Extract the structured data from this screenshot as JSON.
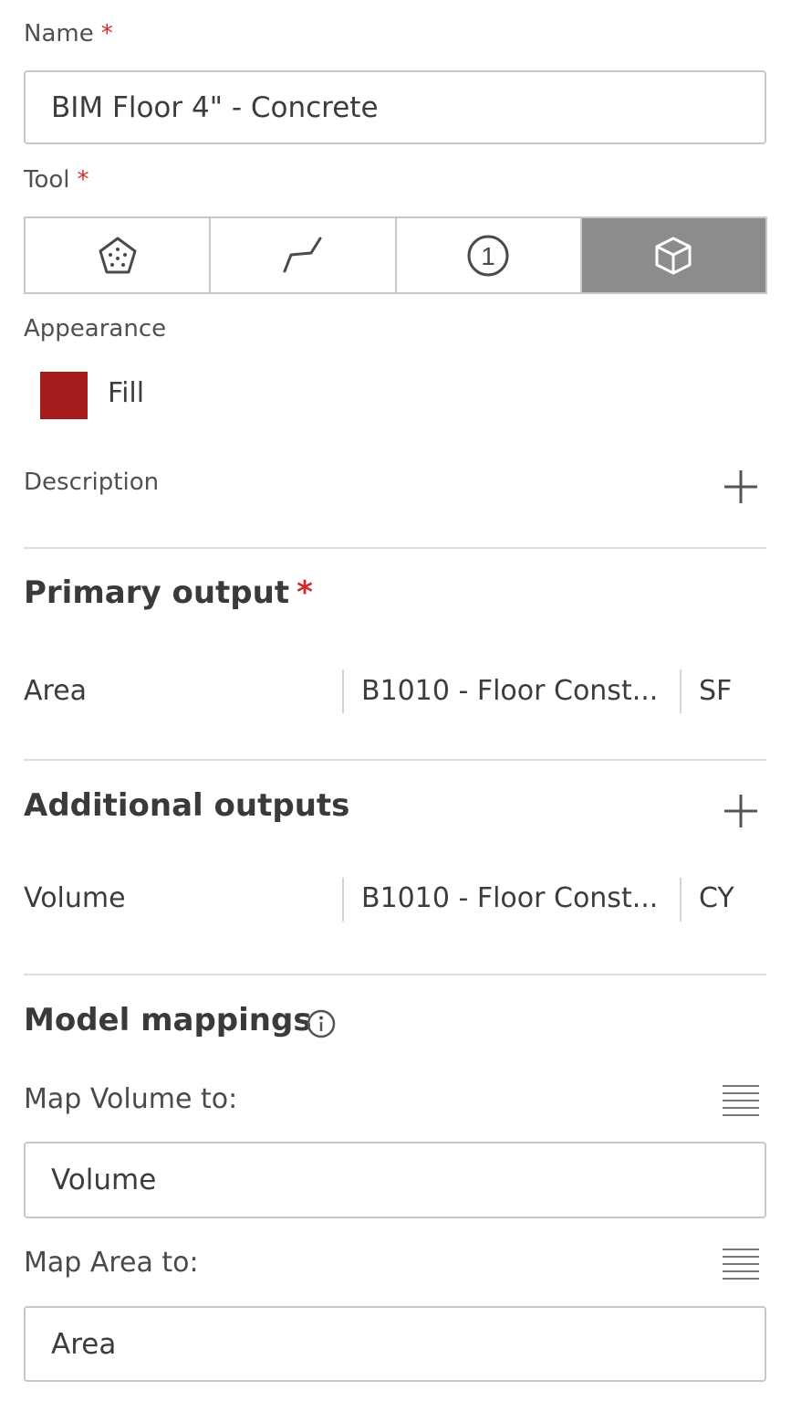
{
  "name_field": {
    "label": "Name",
    "required_mark": "*",
    "value": "BIM Floor 4\" - Concrete"
  },
  "tool_field": {
    "label": "Tool",
    "required_mark": "*",
    "tools": [
      {
        "icon": "area-polygon-icon",
        "active": false
      },
      {
        "icon": "linear-polyline-icon",
        "active": false
      },
      {
        "icon": "count-icon",
        "glyph": "1",
        "active": false
      },
      {
        "icon": "volume-cube-icon",
        "active": true
      }
    ]
  },
  "appearance": {
    "label": "Appearance",
    "swatch_color": "#a51c1c",
    "fill_label": "Fill"
  },
  "description": {
    "label": "Description"
  },
  "primary_output": {
    "title": "Primary output",
    "required_mark": "*",
    "row": {
      "name": "Area",
      "code": "B1010 - Floor Const...",
      "unit": "SF"
    }
  },
  "additional_outputs": {
    "title": "Additional outputs",
    "rows": [
      {
        "name": "Volume",
        "code": "B1010 - Floor Const...",
        "unit": "CY"
      }
    ]
  },
  "model_mappings": {
    "title": "Model mappings",
    "mappings": [
      {
        "label": "Map Volume to:",
        "value": "Volume"
      },
      {
        "label": "Map Area to:",
        "value": "Area"
      }
    ]
  },
  "colors": {
    "accent_required": "#d02a2a",
    "active_tool_bg": "#8c8c8c"
  }
}
